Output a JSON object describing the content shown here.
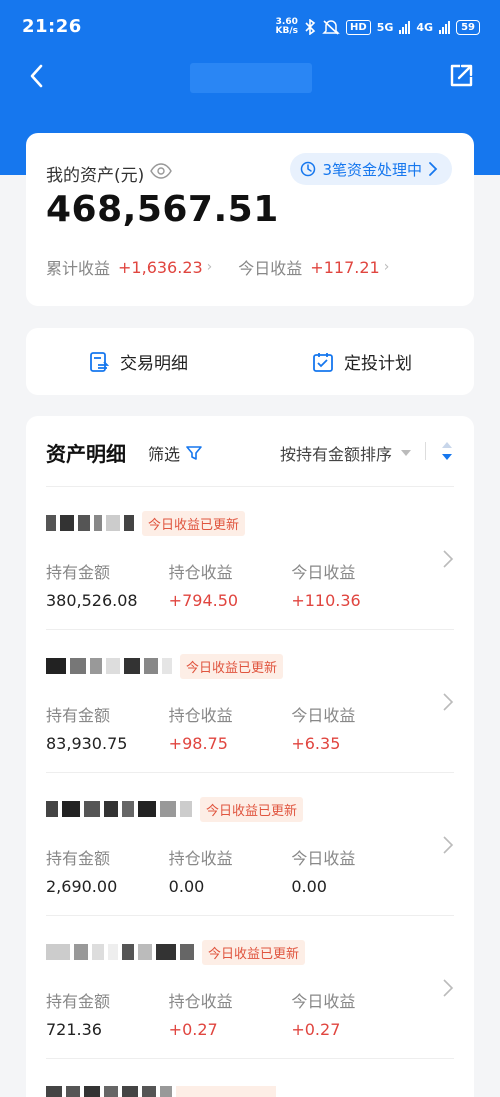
{
  "status": {
    "time": "21:26",
    "speed_top": "3.60",
    "speed_unit": "KB/s",
    "hd": "HD",
    "net1": "5G",
    "net2": "4G",
    "battery": "59"
  },
  "asset": {
    "label": "我的资产(元)",
    "pending": "3笔资金处理中",
    "total": "468,567.51",
    "cumulative_label": "累计收益",
    "cumulative_value": "+1,636.23",
    "today_label": "今日收益",
    "today_value": "+117.21"
  },
  "actions": {
    "detail": "交易明细",
    "plan": "定投计划"
  },
  "list": {
    "title": "资产明细",
    "filter": "筛选",
    "sort": "按持有金额排序"
  },
  "fund_columns": {
    "hold": "持有金额",
    "position_gain": "持仓收益",
    "today_gain": "今日收益"
  },
  "funds": [
    {
      "tag": "今日收益已更新",
      "hold": "380,526.08",
      "position_gain": "+794.50",
      "today_gain": "+110.36"
    },
    {
      "tag": "今日收益已更新",
      "hold": "83,930.75",
      "position_gain": "+98.75",
      "today_gain": "+6.35"
    },
    {
      "tag": "今日收益已更新",
      "hold": "2,690.00",
      "position_gain": "0.00",
      "today_gain": "0.00"
    },
    {
      "tag": "今日收益已更新",
      "hold": "721.36",
      "position_gain": "+0.27",
      "today_gain": "+0.27"
    }
  ],
  "colors": {
    "brand": "#1677ee",
    "gain": "#e0453f",
    "tag_bg": "#fdeee6"
  }
}
